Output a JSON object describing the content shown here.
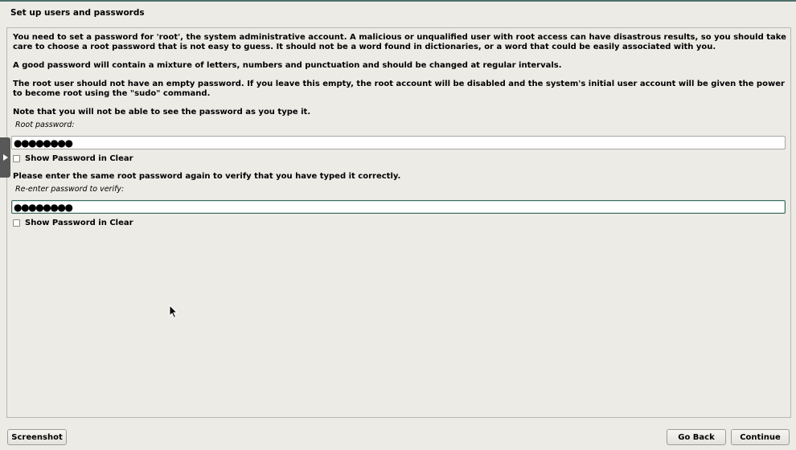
{
  "window": {
    "title": "Set up users and passwords"
  },
  "main": {
    "paragraphs": [
      "You need to set a password for 'root', the system administrative account. A malicious or unqualified user with root access can have disastrous results, so you should take care to choose a root password that is not easy to guess. It should not be a word found in dictionaries, or a word that could be easily associated with you.",
      "A good password will contain a mixture of letters, numbers and punctuation and should be changed at regular intervals.",
      "The root user should not have an empty password. If you leave this empty, the root account will be disabled and the system's initial user account will be given the power to become root using the \"sudo\" command.",
      "Note that you will not be able to see the password as you type it."
    ],
    "root_password": {
      "label": "Root password:",
      "value": "●●●●●●●●",
      "show_clear_label": "Show Password in Clear",
      "show_clear_checked": false
    },
    "verify_prompt": "Please enter the same root password again to verify that you have typed it correctly.",
    "verify_password": {
      "label": "Re-enter password to verify:",
      "value": "●●●●●●●●",
      "show_clear_label": "Show Password in Clear",
      "show_clear_checked": false
    }
  },
  "footer": {
    "screenshot_label": "Screenshot",
    "go_back_label": "Go Back",
    "continue_label": "Continue"
  },
  "icons": {
    "side_handle": "triangle-right-icon",
    "cursor": "mouse-pointer-icon"
  },
  "colors": {
    "background": "#edebe6",
    "accent": "#4f6f6a",
    "focus_border": "#3e6b61"
  }
}
